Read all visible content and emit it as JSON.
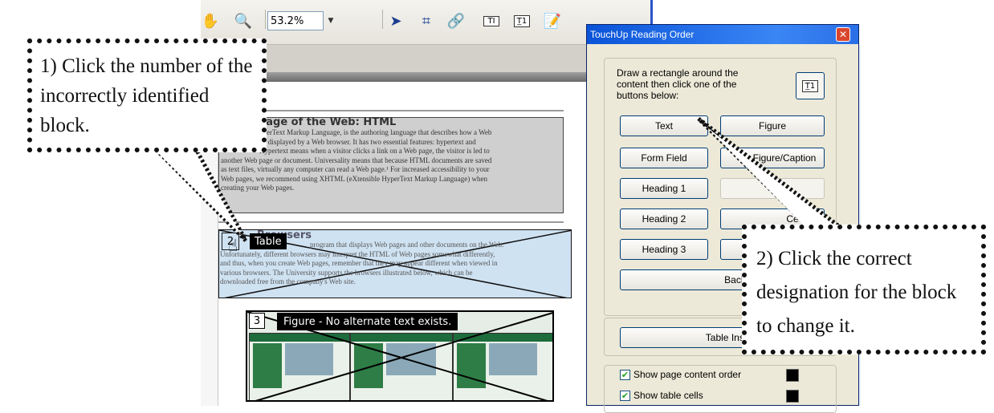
{
  "toolbar": {
    "zoom_value": "53.2%",
    "icons": [
      "hand-tool-icon",
      "zoom-tool-icon",
      "zoom-out-icon",
      "zoom-in-icon",
      "select-arrow-icon",
      "crop-icon",
      "link-icon",
      "touchup-text-icon",
      "reading-order-icon",
      "edit-object-icon"
    ]
  },
  "document": {
    "block1": {
      "heading": "uage of the Web: HTML",
      "lines": [
        "yperText Markup Language, is the authoring language that describes how a Web",
        "be displayed by a Web browser.  It has two essential features: hypertext and",
        "Hypertext means when a visitor clicks a link on a Web page, the visitor is led to",
        "another Web page or document.  Universality means that because HTML documents are saved",
        "as text files, virtually any computer can read a Web page.¹  For increased accessibility to your",
        "Web pages, we recommend using XHTML (eXtensible HyperText Markup Language) when",
        "creating your Web pages."
      ]
    },
    "block2": {
      "number": "2",
      "tooltip": "Table",
      "heading": "Browsers",
      "lines": [
        "program that displays Web pages and other documents on the Web.",
        "Unfortunately, different browsers may interpret the HTML of Web pages somewhat differently,",
        "and thus, when you create Web pages, remember that they may appear different when viewed in",
        "various browsers.  The University supports the browsers illustrated below, which can be",
        "downloaded free from the company's Web site."
      ]
    },
    "block3": {
      "number": "3",
      "tooltip": "Figure - No alternate text exists."
    }
  },
  "dialog": {
    "title": "TouchUp Reading Order",
    "close_label": "✕",
    "instruction": "Draw a rectangle around the content then click one of the buttons below:",
    "buttons": {
      "text": "Text",
      "figure": "Figure",
      "form_field": "Form Field",
      "figure_caption": "Figure/Caption",
      "heading1": "Heading 1",
      "heading2": "Heading 2",
      "cell": "Ce",
      "heading3": "Heading 3",
      "background": "Backgrour",
      "table_inspector": "Table Inspe"
    },
    "checkboxes": [
      {
        "label": "Show page content order",
        "checked": true,
        "swatch_color": "#000000"
      },
      {
        "label": "Show table cells",
        "checked": true,
        "swatch_color": "#000000"
      }
    ]
  },
  "callouts": {
    "step1": "1) Click the number of the incorrectly identified block.",
    "step2": "2) Click the correct designation for the block to change it."
  },
  "colors": {
    "title_bar": "#0a53d8",
    "dialog_bg": "#ece9d8",
    "block_highlight": "#cfe2f2",
    "divider": "#2a54c8"
  }
}
